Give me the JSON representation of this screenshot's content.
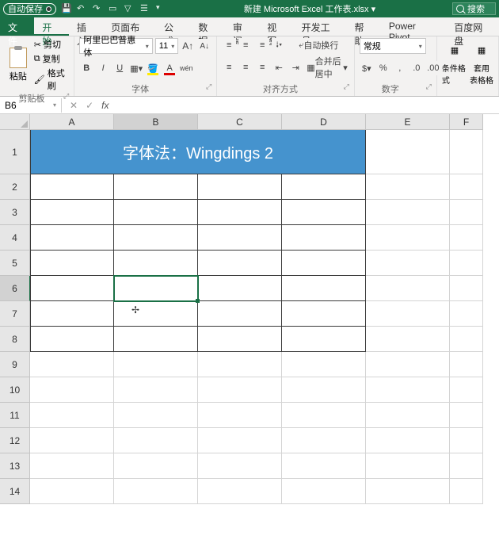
{
  "titlebar": {
    "autosave_label": "自动保存",
    "filename": "新建 Microsoft Excel 工作表.xlsx",
    "search_icon_label": "搜索"
  },
  "tabs": {
    "file": "文件",
    "home": "开始",
    "insert": "插入",
    "page_layout": "页面布局",
    "formulas": "公式",
    "data": "数据",
    "review": "审阅",
    "view": "视图",
    "developer": "开发工具",
    "help": "帮助",
    "power_pivot": "Power Pivot",
    "baidu": "百度网盘"
  },
  "ribbon": {
    "clipboard": {
      "paste": "粘贴",
      "cut": "剪切",
      "copy": "复制",
      "format_painter": "格式刷",
      "group_label": "剪贴板"
    },
    "font": {
      "name": "阿里巴巴普惠体",
      "size": "11",
      "bold": "B",
      "italic": "I",
      "underline": "U",
      "wen": "wén",
      "group_label": "字体",
      "grow": "A",
      "shrink": "A"
    },
    "alignment": {
      "wrap": "自动换行",
      "merge": "合并后居中",
      "group_label": "对齐方式"
    },
    "number": {
      "format": "常规",
      "group_label": "数字"
    },
    "styles": {
      "conditional": "条件格式",
      "table": "套用\n表格格"
    }
  },
  "name_box": {
    "value": "B6"
  },
  "fx": {
    "cancel": "✕",
    "confirm": "✓",
    "fx": "fx"
  },
  "columns": [
    "A",
    "B",
    "C",
    "D",
    "E",
    "F"
  ],
  "rows": [
    "1",
    "2",
    "3",
    "4",
    "5",
    "6",
    "7",
    "8",
    "9",
    "10",
    "11",
    "12",
    "13",
    "14"
  ],
  "merged_cell_text": "字体法：Wingdings 2",
  "active_cell": {
    "col": "B",
    "row": "6"
  }
}
